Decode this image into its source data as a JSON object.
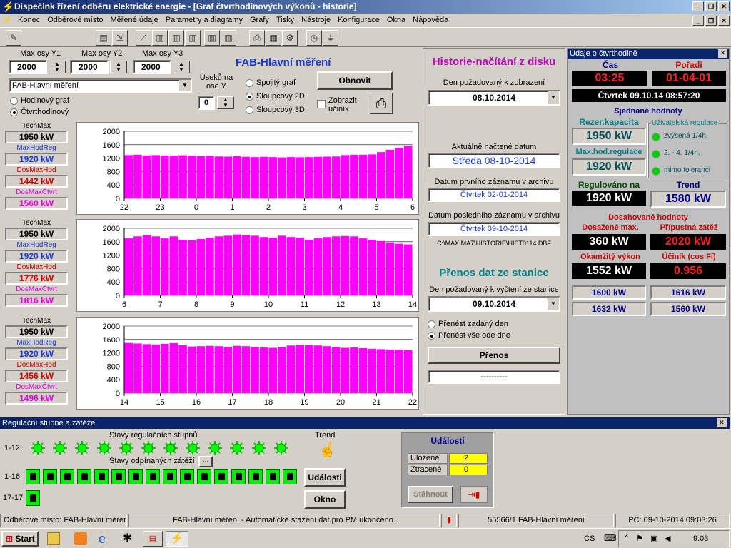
{
  "window": {
    "title": "Dispečink řízení odběru elektrické energie - [Graf čtvrthodinových výkonů - historie]"
  },
  "menu": [
    "Konec",
    "Odběrové místo",
    "Měřené údaje",
    "Parametry a diagramy",
    "Grafy",
    "Tisky",
    "Nástroje",
    "Konfigurace",
    "Okna",
    "Nápověda"
  ],
  "controls": {
    "y1_label": "Max osy Y1",
    "y2_label": "Max osy Y2",
    "y3_label": "Max osy Y3",
    "y1": "2000",
    "y2": "2000",
    "y3": "2000",
    "title": "FAB-Hlavní měření",
    "place": "FAB-Hlavní měření",
    "useku_label": "Úseků na ose Y",
    "useku": "0",
    "r_spojity": "Spojitý graf",
    "r_sloupcovy2d": "Sloupcový 2D",
    "r_sloupcovy3d": "Sloupcový 3D",
    "refresh": "Obnovit",
    "cosphi": "Zobrazit účiník",
    "r_hodinovy": "Hodinový graf",
    "r_ctvrthod": "Čtvrthodinový"
  },
  "panels": [
    {
      "techmax_label": "TechMax",
      "techmax": "1950 kW",
      "maxhod_label": "MaxHodReg",
      "maxhod": "1920 kW",
      "dosmaxhod_label": "DosMaxHod",
      "dosmaxhod": "1442 kW",
      "dosmaxctvrt_label": "DosMaxČtvrt",
      "dosmaxctvrt": "1560 kW"
    },
    {
      "techmax_label": "TechMax",
      "techmax": "1950 kW",
      "maxhod_label": "MaxHodReg",
      "maxhod": "1920 kW",
      "dosmaxhod_label": "DosMaxHod",
      "dosmaxhod": "1776 kW",
      "dosmaxctvrt_label": "DosMaxČtvrt",
      "dosmaxctvrt": "1816 kW"
    },
    {
      "techmax_label": "TechMax",
      "techmax": "1950 kW",
      "maxhod_label": "MaxHodReg",
      "maxhod": "1920 kW",
      "dosmaxhod_label": "DosMaxHod",
      "dosmaxhod": "1456 kW",
      "dosmaxctvrt_label": "DosMaxČtvrt",
      "dosmaxctvrt": "1496 kW"
    }
  ],
  "chart_data": [
    {
      "type": "bar",
      "yticks": [
        "0",
        "400",
        "800",
        "1200",
        "1600",
        "2000"
      ],
      "ylim": [
        0,
        2000
      ],
      "xticks": [
        "22",
        "23",
        "0",
        "1",
        "2",
        "3",
        "4",
        "5",
        "6"
      ],
      "color": "#ff00ff",
      "values": [
        1290,
        1300,
        1280,
        1290,
        1280,
        1270,
        1285,
        1275,
        1260,
        1270,
        1250,
        1245,
        1255,
        1240,
        1230,
        1240,
        1230,
        1220,
        1230,
        1225,
        1230,
        1240,
        1245,
        1250,
        1290,
        1300,
        1300,
        1310,
        1380,
        1450,
        1510,
        1560
      ]
    },
    {
      "type": "bar",
      "yticks": [
        "0",
        "400",
        "800",
        "1200",
        "1600",
        "2000"
      ],
      "ylim": [
        0,
        2000
      ],
      "xticks": [
        "6",
        "7",
        "8",
        "9",
        "10",
        "11",
        "12",
        "13",
        "14"
      ],
      "color": "#ff00ff",
      "values": [
        1700,
        1760,
        1800,
        1760,
        1700,
        1760,
        1660,
        1640,
        1680,
        1720,
        1760,
        1780,
        1816,
        1800,
        1780,
        1740,
        1720,
        1780,
        1740,
        1720,
        1660,
        1700,
        1740,
        1760,
        1770,
        1760,
        1700,
        1660,
        1620,
        1580,
        1540,
        1520
      ]
    },
    {
      "type": "bar",
      "yticks": [
        "0",
        "400",
        "800",
        "1200",
        "1600",
        "2000"
      ],
      "ylim": [
        0,
        2000
      ],
      "xticks": [
        "14",
        "15",
        "16",
        "17",
        "18",
        "19",
        "20",
        "21",
        "22"
      ],
      "color": "#ff00ff",
      "values": [
        1496,
        1480,
        1460,
        1450,
        1470,
        1490,
        1430,
        1390,
        1400,
        1410,
        1400,
        1380,
        1410,
        1400,
        1380,
        1360,
        1350,
        1370,
        1420,
        1440,
        1430,
        1420,
        1400,
        1380,
        1350,
        1360,
        1340,
        1320,
        1310,
        1300,
        1290,
        1280
      ]
    }
  ],
  "history": {
    "title": "Historie-načítání z disku",
    "den_label": "Den požadovaný k zobrazení",
    "den": "08.10.2014",
    "akt_label": "Aktuálně načtené datum",
    "akt": "Středa  08-10-2014",
    "prvni_label": "Datum prvního záznamu v archivu",
    "prvni": "Čtvrtek  02-01-2014",
    "posl_label": "Datum posledního záznamu v archivu",
    "posl": "Čtvrtek 09-10-2014",
    "path": "C:\\MAXIMA7\\HISTORIE\\HIST0114.DBF"
  },
  "transfer": {
    "title": "Přenos dat ze stanice",
    "den_label": "Den požadovaný k vyčtení ze stanice",
    "den": "09.10.2014",
    "r1": "Přenést zadaný den",
    "r2": "Přenést vše ode dne",
    "btn": "Přenos",
    "status": "----------"
  },
  "qh": {
    "title": "Údaje o čtvrthodině",
    "cas_label": "Čas",
    "cas": "03:25",
    "poradi_label": "Pořadí",
    "poradi": "01-04-01",
    "datetime": "Čtvrtek  09.10.14  08:57:20",
    "sjednane": "Sjednané hodnoty",
    "rezer_label": "Rezer.kapacita",
    "rezer": "1950 kW",
    "maxreg_label": "Max.hod.regulace",
    "maxreg": "1920 kW",
    "uziv": "Uživatelská regulace",
    "u1": "zvýšená 1/4h.",
    "u2": "2. - 4. 1/4h.",
    "u3": "mimo toleranci",
    "reg_label": "Regulováno na",
    "reg": "1920 kW",
    "trend_label": "Trend",
    "trend": "1580 kW",
    "dosah": "Dosahované hodnoty",
    "dosmax_label": "Dosažené max.",
    "dosmax": "360 kW",
    "pripust_label": "Přípustná zátěž",
    "pripust": "2020 kW",
    "okam_label": "Okamžitý výkon",
    "okam": "1552 kW",
    "cos_label": "Účiník (cos Fí)",
    "cos": "0.956",
    "v1": "1600 kW",
    "v2": "1616 kW",
    "v3": "1632 kW",
    "v4": "1560 kW"
  },
  "reg": {
    "title": "Regulační stupně a zátěže",
    "stavy": "Stavy regulačních stupňů",
    "r112": "1-12",
    "odpin": "Stavy odpínaných zátěží",
    "dots_btn": "...",
    "r116": "1-16",
    "r1717": "17-17",
    "trend": "Trend",
    "udalosti_btn": "Události",
    "okno_btn": "Okno",
    "ud_title": "Události",
    "ulozene_label": "Uložené",
    "ulozene": "2",
    "ztracene_label": "Ztracené",
    "ztracene": "0",
    "stahnout": "Stáhnout"
  },
  "status": {
    "s1": "Odběrové místo: FAB-Hlavní měření",
    "s2": "FAB-Hlavní měření - Automatické stažení dat pro PM ukončeno.",
    "s3": "55566/1 FAB-Hlavní měření",
    "s4": "PC: 09-10-2014 09:03:26"
  },
  "taskbar": {
    "start": "Start",
    "lang": "CS",
    "clock": "9:03"
  }
}
